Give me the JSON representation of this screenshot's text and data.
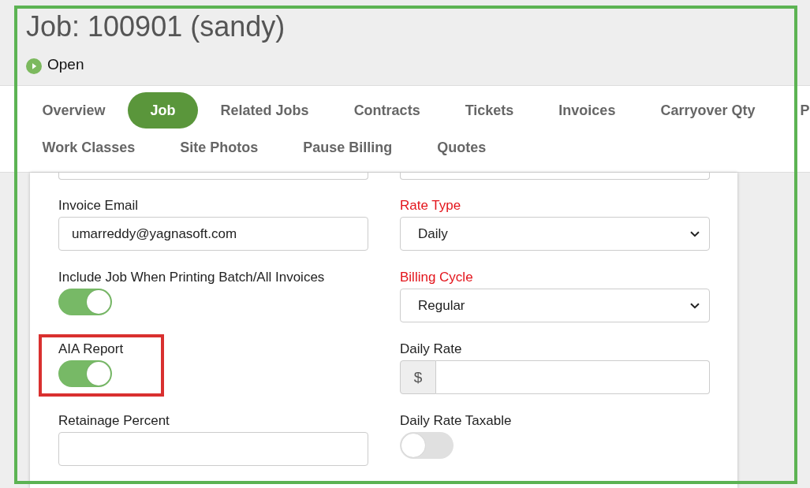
{
  "annotation_frame": true,
  "job_title": "Job: 100901 (sandy)",
  "status": {
    "label": "Open"
  },
  "tabs": [
    {
      "label": "Overview",
      "selected": false
    },
    {
      "label": "Job",
      "selected": true
    },
    {
      "label": "Related Jobs",
      "selected": false
    },
    {
      "label": "Contracts",
      "selected": false
    },
    {
      "label": "Tickets",
      "selected": false
    },
    {
      "label": "Invoices",
      "selected": false
    },
    {
      "label": "Carryover Qty",
      "selected": false
    },
    {
      "label": "P",
      "selected": false
    },
    {
      "label": "Work Classes",
      "selected": false
    },
    {
      "label": "Site Photos",
      "selected": false
    },
    {
      "label": "Pause Billing",
      "selected": false
    },
    {
      "label": "Quotes",
      "selected": false
    }
  ],
  "form": {
    "columns": [
      [
        {
          "kind": "cut"
        },
        {
          "kind": "input",
          "label": "Invoice Email",
          "required": false,
          "highlighted": false,
          "value": "umarreddy@yagnasoft.com"
        },
        {
          "kind": "toggle",
          "label": "Include Job When Printing Batch/All Invoices",
          "required": false,
          "highlighted": false,
          "on": true
        },
        {
          "kind": "toggle",
          "label": "AIA Report",
          "required": false,
          "highlighted": true,
          "on": true
        },
        {
          "kind": "input",
          "label": "Retainage Percent",
          "required": false,
          "highlighted": false
        }
      ],
      [
        {
          "kind": "cut"
        },
        {
          "kind": "select",
          "label": "Rate Type",
          "required": true,
          "highlighted": false,
          "value": "Daily"
        },
        {
          "kind": "select",
          "label": "Billing Cycle",
          "required": true,
          "highlighted": false,
          "value": "Regular"
        },
        {
          "kind": "currency",
          "label": "Daily Rate",
          "required": false,
          "highlighted": false,
          "prefix": "$"
        },
        {
          "kind": "toggle",
          "label": "Daily Rate Taxable",
          "required": false,
          "highlighted": false,
          "on": false
        }
      ]
    ]
  }
}
